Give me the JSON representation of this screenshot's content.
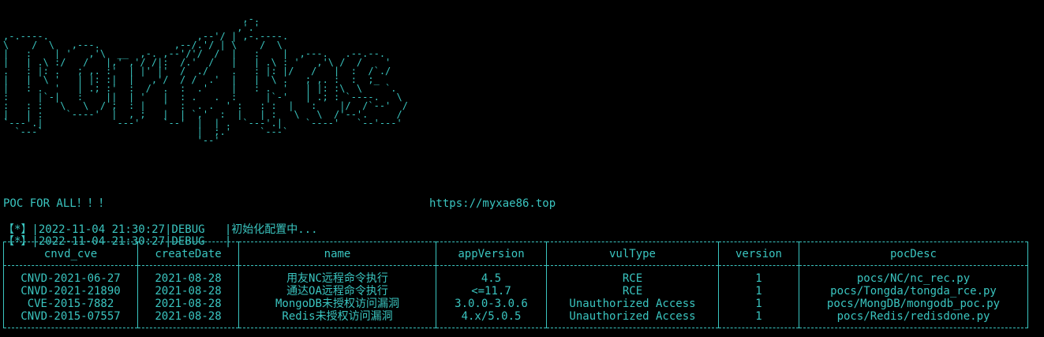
{
  "terminal": {
    "background": "#000000",
    "text_color": "#3ac5c0",
    "banner_ascii": "                                          ,-.\n                                         ,'.'\n,-.----.                          ,--'/ | ,-.----.\n\\    /  \\   ,---.             ,--/.'/ | \\    /  \\\n|   :    | '   ,'\\  __  ,-. ,--'/'/  /  |   :    |  ,---.   .--.--.\n|   | .\\ :/   /   |,' ,'/ /|:  /.'  /   |   | .\\ : '   ,'\\ /  /    '\n.   : |: .   ; ,. :'  | |' |'  /  ./    .   : |: |/   /   |  :  /`./\n|   |  \\ '   | |: :|  |   ,'/  / /  .'  |   |  \\ .   ; ,. :  :  ;_\n|   : .  '   | .; :'  :  /  .  :  .'    |   : .  '   | |: :\\  \\    `.\n:     |`-|   :    ||  | '   |  : .   .  :     |`-'   | .; : `----.   \\\n:   : :   \\   \\  / ;  : |   '  :  . .  ' :   : :  |   :    |/  /`--'  /\n|   | :    `----'  |  , ;   |  | `,'  :  |   | :   \\   \\  /'--'.     /\n`---'.|             ---'    `--'  |  | .  `---'.|    `----'   `--'---'\n  `---`                           |  ;.'     `---`\n                                  '--'",
    "tagline": "POC FOR ALL！！！",
    "url": "https://myxae86.top",
    "logs": [
      "【*】|2022-11-04 21:30:27|DEBUG   |初始化配置中...",
      "【*】|2022-11-04 21:30:27|DEBUG   |"
    ],
    "table": {
      "headers": [
        "cnvd_cve",
        "createDate",
        "name",
        "appVersion",
        "vulType",
        "version",
        "pocDesc"
      ],
      "rows": [
        [
          "CNVD-2021-06-27",
          "2021-08-28",
          "用友NC远程命令执行",
          "4.5",
          "RCE",
          "1",
          "pocs/NC/nc_rec.py"
        ],
        [
          "CNVD-2021-21890",
          "2021-08-28",
          "通达OA远程命令执行",
          "<=11.7",
          "RCE",
          "1",
          "pocs/Tongda/tongda_rce.py"
        ],
        [
          "CVE-2015-7882",
          "2021-08-28",
          "MongoDB未授权访问漏洞",
          "3.0.0-3.0.6",
          "Unauthorized Access",
          "1",
          "pocs/MongDB/mongodb_poc.py"
        ],
        [
          "CNVD-2015-07557",
          "2021-08-28",
          "Redis未授权访问漏洞",
          "4.x/5.0.5",
          "Unauthorized Access",
          "1",
          "pocs/Redis/redisdone.py"
        ]
      ]
    }
  }
}
